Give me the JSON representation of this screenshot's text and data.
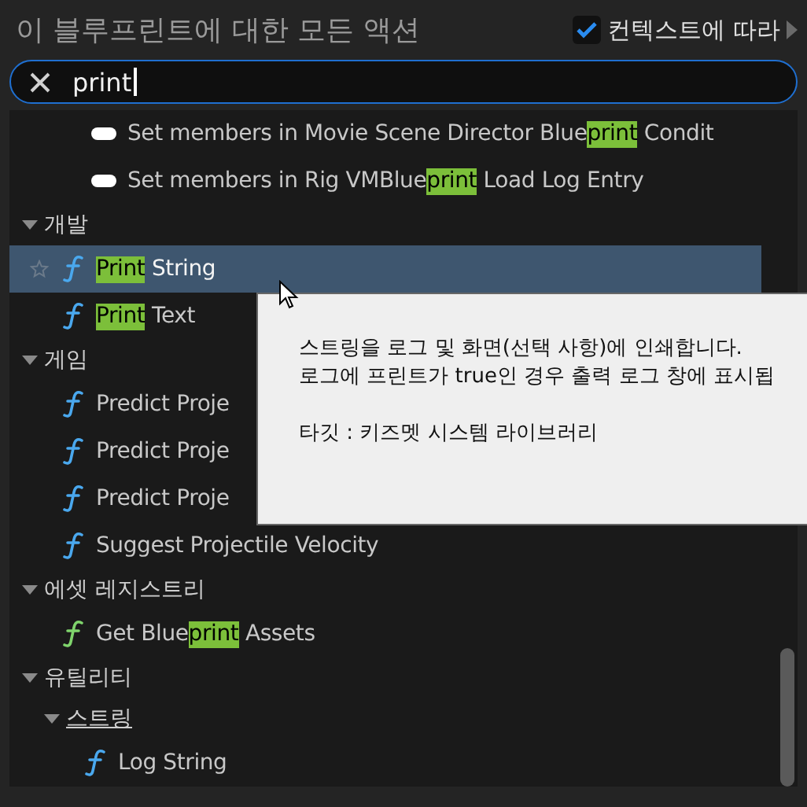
{
  "header": {
    "title": "이 블루프린트에 대한 모든 액션",
    "context_checkbox": {
      "label": "컨텍스트에 따라",
      "checked": true
    }
  },
  "search": {
    "value": "print"
  },
  "tree": [
    {
      "kind": "member",
      "color": "#ffffff",
      "selected": false,
      "parts": [
        {
          "text": "Set members in Movie Scene Director Blue",
          "highlight": false
        },
        {
          "text": "print",
          "highlight": true
        },
        {
          "text": " Condit",
          "highlight": false
        }
      ]
    },
    {
      "kind": "member",
      "color": "#ffffff",
      "selected": false,
      "parts": [
        {
          "text": "Set members in Rig VMBlue",
          "highlight": false
        },
        {
          "text": "print",
          "highlight": true
        },
        {
          "text": " Load Log Entry",
          "highlight": false
        }
      ]
    },
    {
      "kind": "category",
      "label": "개발",
      "expanded": true,
      "children": [
        {
          "kind": "function",
          "color": "#4aa8ee",
          "selected": true,
          "parts": [
            {
              "text": "Print",
              "highlight": true
            },
            {
              "text": " String",
              "highlight": false
            }
          ]
        },
        {
          "kind": "function",
          "color": "#4aa8ee",
          "selected": false,
          "parts": [
            {
              "text": "Print",
              "highlight": true
            },
            {
              "text": " Text",
              "highlight": false
            }
          ]
        }
      ]
    },
    {
      "kind": "category",
      "label": "게임",
      "expanded": true,
      "children": [
        {
          "kind": "function",
          "color": "#4aa8ee",
          "selected": false,
          "parts": [
            {
              "text": "Predict Proje",
              "highlight": false
            }
          ]
        },
        {
          "kind": "function",
          "color": "#4aa8ee",
          "selected": false,
          "parts": [
            {
              "text": "Predict Proje",
              "highlight": false
            }
          ]
        },
        {
          "kind": "function",
          "color": "#4aa8ee",
          "selected": false,
          "parts": [
            {
              "text": "Predict Proje",
              "highlight": false
            }
          ]
        },
        {
          "kind": "function",
          "color": "#4aa8ee",
          "selected": false,
          "parts": [
            {
              "text": "Suggest Projectile Velocity",
              "highlight": false
            }
          ]
        }
      ]
    },
    {
      "kind": "category",
      "label": "에셋 레지스트리",
      "expanded": true,
      "children": [
        {
          "kind": "function",
          "color": "#7fd46c",
          "selected": false,
          "parts": [
            {
              "text": "Get Blue",
              "highlight": false
            },
            {
              "text": "print",
              "highlight": true
            },
            {
              "text": " Assets",
              "highlight": false
            }
          ]
        }
      ]
    },
    {
      "kind": "category",
      "label": "유틸리티",
      "expanded": true,
      "children": [
        {
          "kind": "category",
          "label": "스트링",
          "expanded": true,
          "children": [
            {
              "kind": "function",
              "color": "#4aa8ee",
              "selected": false,
              "parts": [
                {
                  "text": "Log String",
                  "highlight": false
                }
              ]
            }
          ]
        }
      ]
    }
  ],
  "tooltip": {
    "lines": [
      "스트링을 로그 및 화면(선택 사항)에 인쇄합니다.",
      "로그에 프린트가 true인 경우 출력 로그 창에 표시됩"
    ],
    "target": "타깃 : 키즈멧 시스템 라이브러리"
  }
}
